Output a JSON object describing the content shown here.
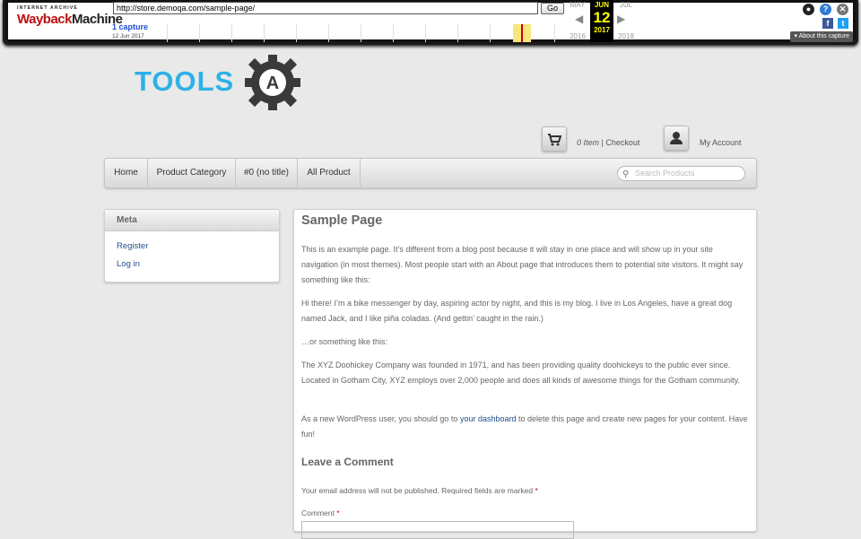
{
  "wayback": {
    "logo_top": "INTERNET ARCHIVE",
    "logo_main_a": "Wayback",
    "logo_main_b": "Machine",
    "url": "http://store.demoqa.com/sample-page/",
    "go": "Go",
    "captures": "1 capture",
    "capture_date": "12 Jun 2017",
    "months": {
      "prev": "MAY",
      "current": "JUN",
      "next": "JUL"
    },
    "day": "12",
    "years": {
      "prev": "2016",
      "current": "2017",
      "next": "2018"
    },
    "about": "About this capture",
    "icons": [
      "user-icon",
      "help-icon",
      "close-icon",
      "facebook-icon",
      "twitter-icon"
    ]
  },
  "site": {
    "logo_text": "TOOLS",
    "logo_badge": "A",
    "cart_count": "0 Item",
    "cart_sep": "|",
    "checkout": "Checkout",
    "my_account": "My Account"
  },
  "nav": {
    "items": [
      "Home",
      "Product Category",
      "#0 (no title)",
      "All Product"
    ],
    "search_placeholder": "Search Products"
  },
  "sidebar": {
    "title": "Meta",
    "links": [
      "Register",
      "Log in"
    ]
  },
  "page": {
    "title": "Sample Page",
    "p1": "This is an example page. It’s different from a blog post because it will stay in one place and will show up in your site navigation (in most themes). Most people start with an About page that introduces them to potential site visitors. It might say something like this:",
    "p2": "Hi there! I’m a bike messenger by day, aspiring actor by night, and this is my blog. I live in Los Angeles, have a great dog named Jack, and I like piña coladas. (And gettin’ caught in the rain.)",
    "p3": "…or something like this:",
    "p4": "The XYZ Doohickey Company was founded in 1971, and has been providing quality doohickeys to the public ever since. Located in Gotham City, XYZ employs over 2,000 people and does all kinds of awesome things for the Gotham community.",
    "p5_before": "As a new WordPress user, you should go to ",
    "p5_link": "your dashboard",
    "p5_after": " to delete this page and create new pages for your content. Have fun!",
    "comment_heading": "Leave a Comment",
    "note": "Your email address will not be published. Required fields are marked",
    "required_mark": "*",
    "comment_label": "Comment"
  }
}
